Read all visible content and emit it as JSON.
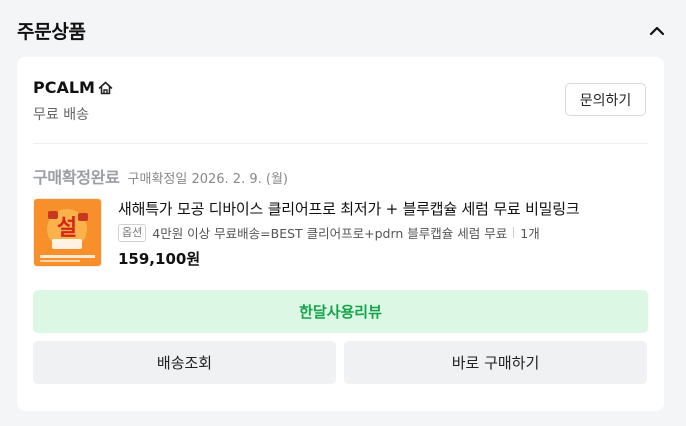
{
  "section": {
    "title": "주문상품"
  },
  "seller": {
    "name": "PCALM",
    "shipping": "무료 배송",
    "inquiry_label": "문의하기"
  },
  "order": {
    "status": "구매확정완료",
    "confirmed_date": "구매확정일 2026. 2. 9. (월)"
  },
  "product": {
    "name": "새해특가 모공 디바이스 클리어프로 최저가 + 블루캡슐 세럼 무료 비밀링크",
    "option_badge": "옵션",
    "option": "4만원 이상 무료배송=BEST 클리어프로+pdrn 블루캡슐 세럼 무료",
    "quantity": "1개",
    "price": "159,100원",
    "thumb_text": "설"
  },
  "actions": {
    "review": "한달사용리뷰",
    "track": "배송조회",
    "buy_again": "바로 구매하기"
  },
  "colors": {
    "review_bg": "#dcf8e4",
    "review_text": "#16a34a",
    "thumb_bg": "#f7902a"
  },
  "icons": {
    "collapse": "chevron-up-icon",
    "store": "home-icon"
  }
}
